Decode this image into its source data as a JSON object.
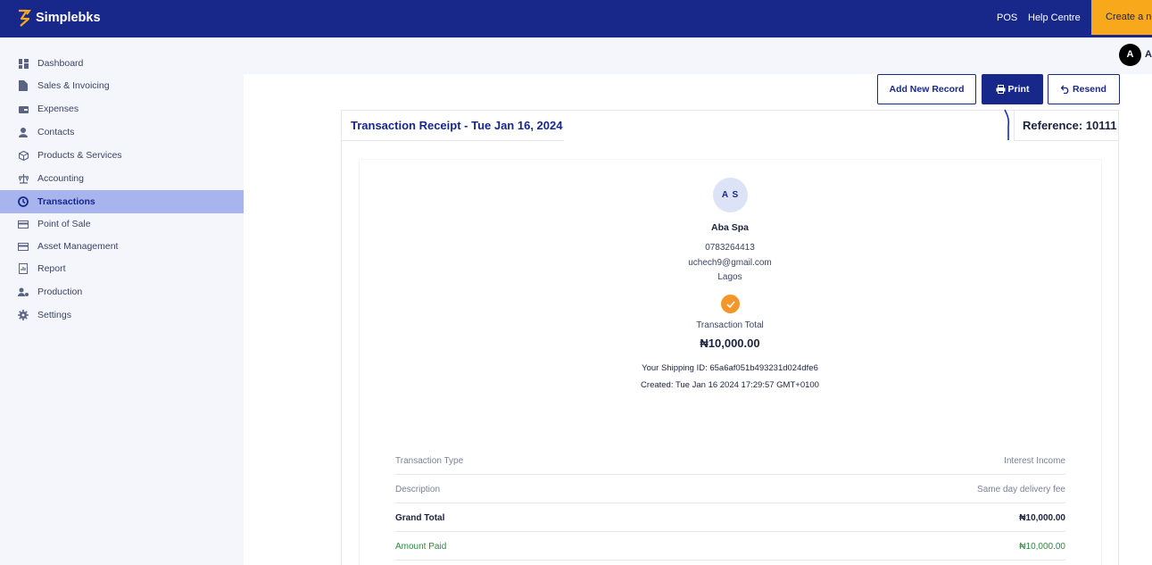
{
  "header": {
    "brand": "Simplebks",
    "links": [
      "POS",
      "Help Centre"
    ],
    "create_label": "Create a n",
    "avatar_initial": "A",
    "avatar_name": "A"
  },
  "sidebar": {
    "items": [
      {
        "label": "Dashboard",
        "icon": "dashboard-icon"
      },
      {
        "label": "Sales & Invoicing",
        "icon": "document-icon"
      },
      {
        "label": "Expenses",
        "icon": "wallet-icon"
      },
      {
        "label": "Contacts",
        "icon": "person-icon"
      },
      {
        "label": "Products & Services",
        "icon": "box-icon"
      },
      {
        "label": "Accounting",
        "icon": "scale-icon"
      },
      {
        "label": "Transactions",
        "icon": "transactions-icon",
        "active": true
      },
      {
        "label": "Point of Sale",
        "icon": "card-icon"
      },
      {
        "label": "Asset Management",
        "icon": "card-icon"
      },
      {
        "label": "Report",
        "icon": "report-icon"
      },
      {
        "label": "Production",
        "icon": "production-icon"
      },
      {
        "label": "Settings",
        "icon": "gear-icon"
      }
    ]
  },
  "actions": {
    "add": "Add New Record",
    "print": "Print",
    "resend": "Resend"
  },
  "receipt": {
    "title": "Transaction Receipt - Tue Jan 16, 2024",
    "reference": "Reference: 10111",
    "initials": "A S",
    "name": "Aba Spa",
    "phone": "0783264413",
    "email": "uchech9@gmail.com",
    "city": "Lagos",
    "total_label": "Transaction Total",
    "total_value": "₦10,000.00",
    "shipping": "Your Shipping ID: 65a6af051b493231d024dfe6",
    "created": "Created: Tue Jan 16 2024 17:29:57 GMT+0100",
    "rows": [
      {
        "label": "Transaction Type",
        "value": "Interest Income"
      },
      {
        "label": "Description",
        "value": "Same day delivery fee"
      },
      {
        "label": "Grand Total",
        "value": "₦10,000.00"
      },
      {
        "label": "Amount Paid",
        "value": "₦10,000.00"
      }
    ]
  },
  "colors": {
    "brand": "#17288a",
    "accent": "#f8a81b",
    "active_nav": "#a8b4ee",
    "check": "#f5962a",
    "paid": "#2b8a3e"
  }
}
